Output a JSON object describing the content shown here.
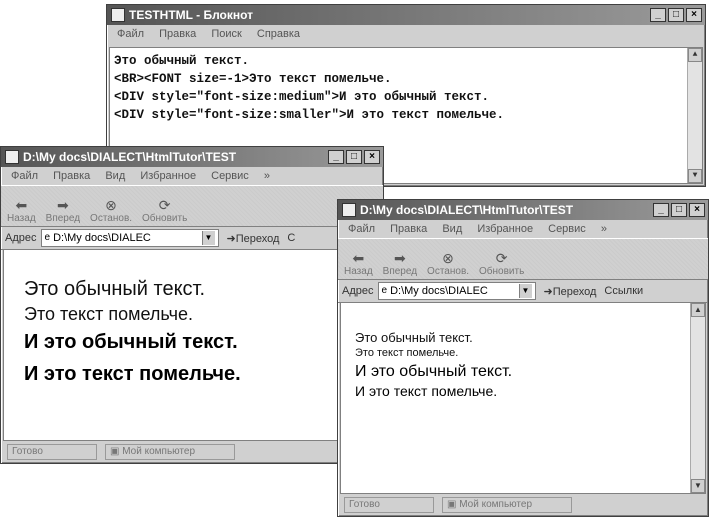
{
  "notepad": {
    "title": "TESTHTML - Блокнот",
    "menu": [
      "Файл",
      "Правка",
      "Поиск",
      "Справка"
    ],
    "lines": [
      "Это обычный текст.",
      "<BR><FONT size=-1>Это текст помельче.",
      "<DIV style=\"font-size:medium\">И это обычный текст.",
      "<DIV style=\"font-size:smaller\">И это текст помельче."
    ]
  },
  "browser_left": {
    "title": "D:\\My docs\\DIALECT\\HtmlTutor\\TEST",
    "menu": [
      "Файл",
      "Правка",
      "Вид",
      "Избранное",
      "Сервис"
    ],
    "toolbar": [
      "Назад",
      "Вперед",
      "Останов.",
      "Обновить"
    ],
    "address_label": "Адрес",
    "address_value": "D:\\My docs\\DIALEC",
    "go_label": "Переход",
    "extra_label": "С",
    "content": [
      "Это обычный текст.",
      "Это текст помельче.",
      "И это обычный текст.",
      "И это текст помельче."
    ],
    "status_ready": "Готово",
    "status_zone": "Мой компьютер"
  },
  "browser_right": {
    "title": "D:\\My docs\\DIALECT\\HtmlTutor\\TEST",
    "menu": [
      "Файл",
      "Правка",
      "Вид",
      "Избранное",
      "Сервис"
    ],
    "toolbar": [
      "Назад",
      "Вперед",
      "Останов.",
      "Обновить"
    ],
    "address_label": "Адрес",
    "address_value": "D:\\My docs\\DIALEC",
    "go_label": "Переход",
    "extra_label": "Ссылки",
    "content": [
      "Это обычный текст.",
      "Это текст помельче.",
      "И это обычный текст.",
      "И это текст помельче."
    ],
    "status_ready": "Готово",
    "status_zone": "Мой компьютер"
  },
  "controls": {
    "minimize": "_",
    "maximize": "□",
    "close": "×",
    "more": "»"
  },
  "icons": {
    "notepad": "notepad-icon",
    "ie_page": "ie-page-icon",
    "back": "back-arrow-icon",
    "forward": "forward-arrow-icon",
    "stop": "stop-icon",
    "refresh": "refresh-icon",
    "go": "go-arrow-icon",
    "computer": "computer-icon"
  }
}
